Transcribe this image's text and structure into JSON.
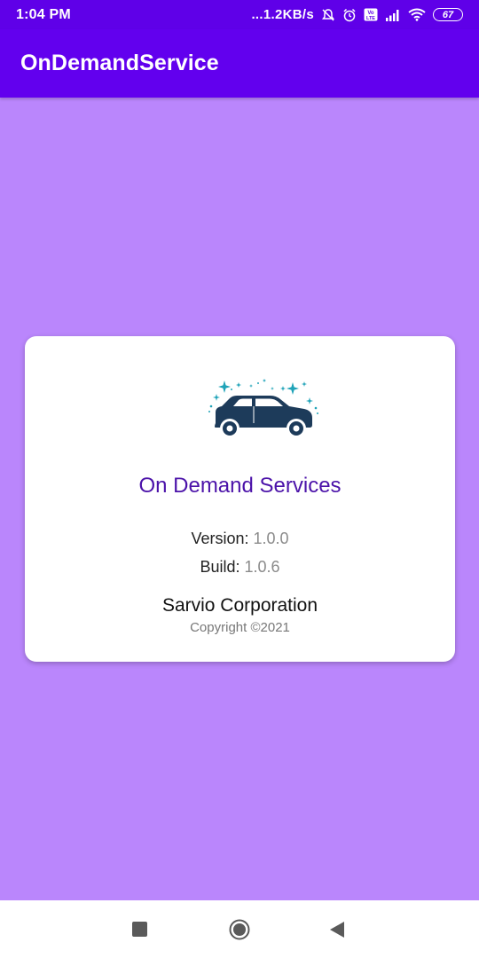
{
  "status_bar": {
    "time": "1:04 PM",
    "network_speed": "...1.2KB/s",
    "battery_level": "67",
    "icons": [
      "mute-alarm-icon",
      "alarm-icon",
      "volte-icon",
      "signal-icon",
      "wifi-icon",
      "battery-icon"
    ]
  },
  "app_bar": {
    "title": "OnDemandService"
  },
  "about": {
    "service_name": "On Demand Services",
    "version_label": "Version:",
    "version_value": "1.0.0",
    "build_label": "Build:",
    "build_value": "1.0.6",
    "company": "Sarvio Corporation",
    "copyright": "Copyright ©2021",
    "logo_icon": "car-wash-icon"
  },
  "nav_bar": {
    "buttons": [
      "recents-button",
      "home-button",
      "back-button"
    ]
  },
  "colors": {
    "status_bar": "#5f00e8",
    "app_bar": "#6200ee",
    "background": "#ba86fc",
    "title_text": "#4b12a9",
    "car": "#1d3b5a",
    "sparkle": "#1fa3b8"
  }
}
